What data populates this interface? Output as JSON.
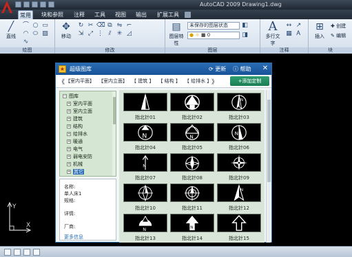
{
  "window": {
    "title": "AutoCAD 2009  Drawing1.dwg"
  },
  "tabs": [
    "常用",
    "块和参照",
    "注释",
    "工具",
    "视图",
    "输出",
    "扩展工具"
  ],
  "active_tab": "常用",
  "ribbon": {
    "groups": [
      {
        "label": "绘图",
        "buttons": [
          "直线"
        ]
      },
      {
        "label": "修改",
        "buttons": [
          "移动"
        ]
      },
      {
        "label": "图层",
        "buttons": [
          "图层特性"
        ]
      },
      {
        "label": "注释",
        "buttons": [
          "多行文字"
        ]
      },
      {
        "label": "块",
        "buttons": [
          "插入"
        ]
      }
    ],
    "layer_state": "未保存的图层状态",
    "layer_name": "0",
    "block_create": "创建",
    "block_edit": "编辑"
  },
  "dialog": {
    "title": "超级图库",
    "refresh_label": "更新",
    "help_label": "帮助",
    "close_label": "✕",
    "nav_prev": "《",
    "nav_next": "》",
    "categories": [
      "【室内平面】",
      "【室内立面】",
      "【 建筑 】",
      "【 结构 】",
      "【 给排水 】"
    ],
    "add_button": "+添加定制",
    "tree": {
      "root": "图库",
      "items": [
        "室内平面",
        "室内立面",
        "建筑",
        "结构",
        "给排水",
        "暖通",
        "电气",
        "弱电安防",
        "机械",
        "其它"
      ],
      "selected_index": 9
    },
    "info": {
      "name_label": "名称:",
      "name_value": "单人床1",
      "spec_label": "规格:",
      "detail_label": "详情:",
      "vendor_label": "厂商:",
      "more_link": "更多信息"
    },
    "symbols": [
      "指北针01",
      "指北针02",
      "指北针03",
      "指北针04",
      "指北针05",
      "指北针06",
      "指北针07",
      "指北针08",
      "指北针09",
      "指北针10",
      "指北针11",
      "指北针12",
      "指北针13",
      "指北针14",
      "指北针15"
    ],
    "symbol_icons": [
      "north-arrow-triangle-icon",
      "north-arrow-circle-icon",
      "north-arrow-half-icon",
      "north-arrow-n-circle-icon",
      "north-arrow-filled-circle-icon",
      "north-arrow-n-split-icon",
      "north-arrow-plain-icon",
      "north-arrow-star-icon",
      "north-arrow-compass-icon",
      "north-arrow-rose-icon",
      "north-arrow-crosshair-icon",
      "north-arrow-dart-icon",
      "north-arrow-dome-icon",
      "north-arrow-bold-icon",
      "north-arrow-block-icon"
    ]
  },
  "ucs": {
    "x": "X",
    "y": "Y"
  },
  "colors": {
    "dialog_title": "#2a6cb4",
    "add_button": "#1b7d54",
    "tree_bg": "#d5e7d2",
    "drawing_bg": "#000000"
  }
}
